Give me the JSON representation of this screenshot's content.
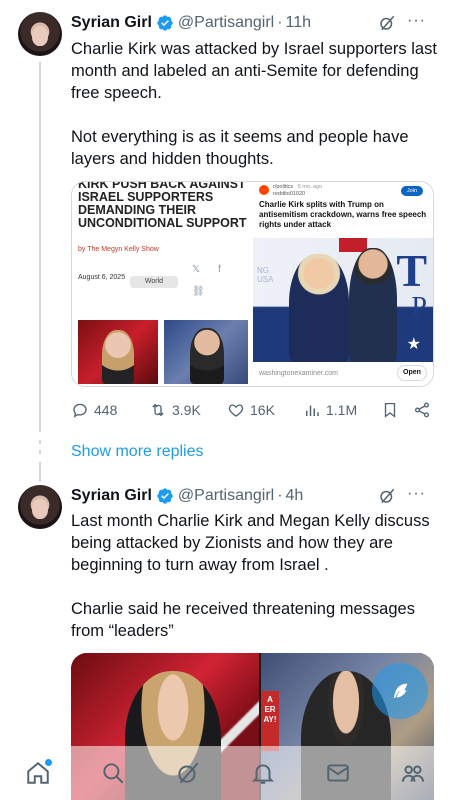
{
  "colors": {
    "accent": "#1d9bf0",
    "text": "#0f1419",
    "muted": "#536471",
    "divider": "#cfd9de"
  },
  "tweets": [
    {
      "author": "Syrian Girl",
      "handle": "@Partisangirl",
      "time": "11h",
      "verified": true,
      "text": "Charlie Kirk was attacked by Israel supporters last month and labeled an anti-Semite for defending free speech.\n\nNot everything is as it seems and people have layers and hidden thoughts.",
      "card": {
        "left": {
          "headline": "KIRK PUSH BACK AGAINST ISRAEL SUPPORTERS DEMANDING THEIR UNCONDITIONAL SUPPORT",
          "byline": "by The Megyn Kelly Show",
          "date": "August 6, 2025",
          "tag": "World"
        },
        "right": {
          "subreddit": "r/politics",
          "age": "5 mo. ago",
          "user": "reddito01020",
          "join_label": "Join",
          "title": "Charlie Kirk splits with Trump on antisemitism crackdown, warns free speech rights under attack",
          "photo_letters": [
            "T",
            "P"
          ],
          "photo_text": "NG\nUSA",
          "source": "washingtonexaminer.com",
          "open_label": "Open"
        }
      },
      "stats": {
        "replies": "448",
        "reposts": "3.9K",
        "likes": "16K",
        "views": "1.1M"
      }
    },
    {
      "author": "Syrian Girl",
      "handle": "@Partisangirl",
      "time": "4h",
      "verified": true,
      "text": "Last month Charlie Kirk and Megan Kelly discuss being attacked by Zionists and how they are beginning to  turn away from Israel .\n\nCharlie said he received threatening messages from “leaders”",
      "media_sign_text": "A\nER\nAY!"
    }
  ],
  "show_more_replies": "Show more replies",
  "separator": "·",
  "more_icon": "···",
  "tabbar": [
    "home-icon",
    "search-icon",
    "grok-icon",
    "notifications-icon",
    "messages-icon",
    "communities-icon"
  ]
}
